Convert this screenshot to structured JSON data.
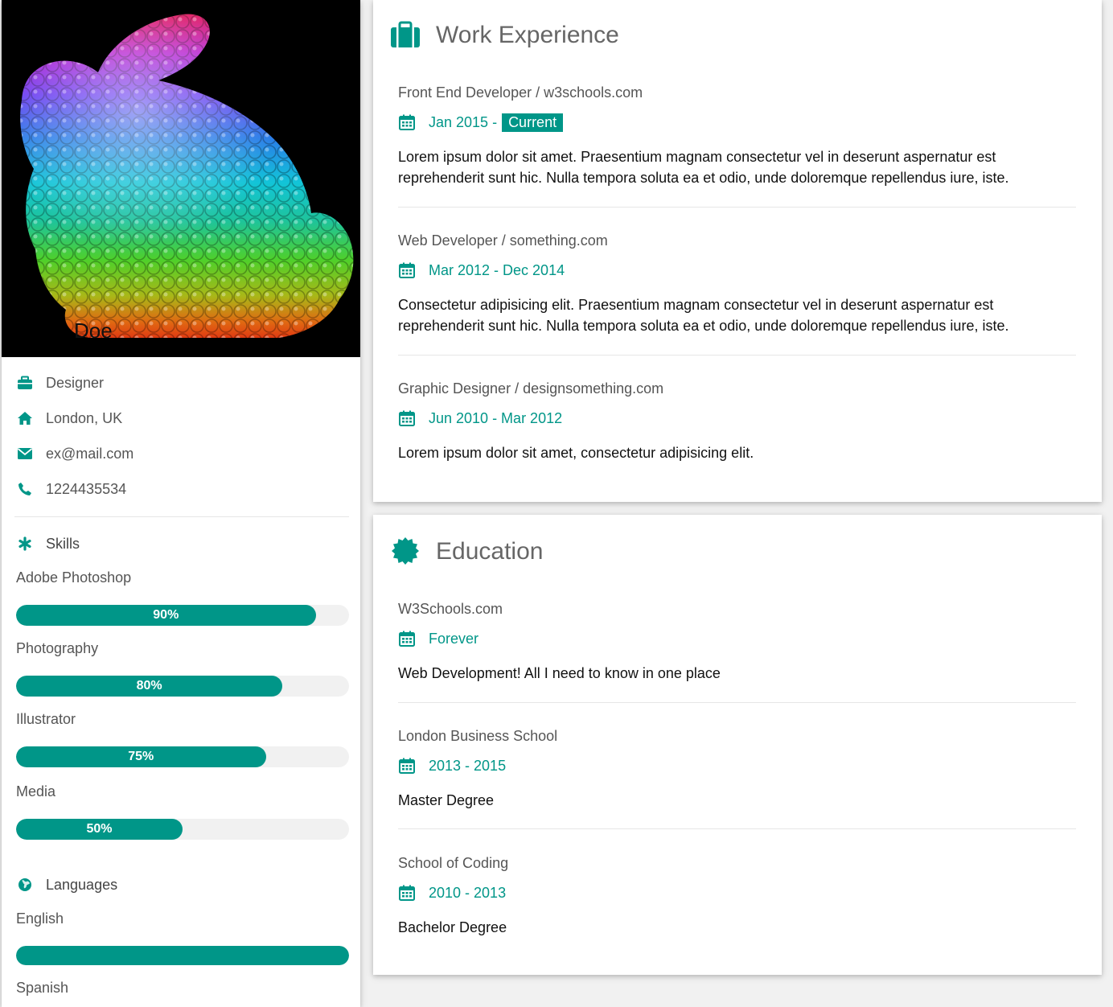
{
  "profile": {
    "portrait_name": "Doe",
    "job": "Designer",
    "location": "London, UK",
    "email": "ex@mail.com",
    "phone": "1224435534"
  },
  "skills": {
    "heading": "Skills",
    "items": [
      {
        "label": "Adobe Photoshop",
        "percent": 90,
        "text": "90%"
      },
      {
        "label": "Photography",
        "percent": 80,
        "text": "80%"
      },
      {
        "label": "Illustrator",
        "percent": 75,
        "text": "75%"
      },
      {
        "label": "Media",
        "percent": 50,
        "text": "50%"
      }
    ]
  },
  "languages": {
    "heading": "Languages",
    "items": [
      {
        "label": "English",
        "percent": 100
      },
      {
        "label": "Spanish"
      }
    ]
  },
  "work": {
    "title": "Work Experience",
    "entries": [
      {
        "title": "Front End Developer / w3schools.com",
        "date": "Jan 2015 - ",
        "badge": "Current",
        "text": "Lorem ipsum dolor sit amet. Praesentium magnam consectetur vel in deserunt aspernatur est reprehenderit sunt hic. Nulla tempora soluta ea et odio, unde doloremque repellendus iure, iste."
      },
      {
        "title": "Web Developer / something.com",
        "date": "Mar 2012 - Dec 2014",
        "text": "Consectetur adipisicing elit. Praesentium magnam consectetur vel in deserunt aspernatur est reprehenderit sunt hic. Nulla tempora soluta ea et odio, unde doloremque repellendus iure, iste."
      },
      {
        "title": "Graphic Designer / designsomething.com",
        "date": "Jun 2010 - Mar 2012",
        "text": "Lorem ipsum dolor sit amet, consectetur adipisicing elit."
      }
    ]
  },
  "education": {
    "title": "Education",
    "entries": [
      {
        "title": "W3Schools.com",
        "date": "Forever",
        "text": "Web Development! All I need to know in one place"
      },
      {
        "title": "London Business School",
        "date": "2013 - 2015",
        "text": "Master Degree"
      },
      {
        "title": "School of Coding",
        "date": "2010 - 2013",
        "text": "Bachelor Degree"
      }
    ]
  },
  "colors": {
    "accent": "#009688",
    "bar_track": "#f1f1f1",
    "page_bg": "#f1f1f1"
  },
  "icons": {
    "job": "briefcase-icon",
    "location": "home-icon",
    "email": "envelope-icon",
    "phone": "phone-icon",
    "skills": "asterisk-icon",
    "languages": "globe-icon",
    "work": "suitcase-icon",
    "education": "certificate-icon",
    "date": "calendar-icon"
  }
}
